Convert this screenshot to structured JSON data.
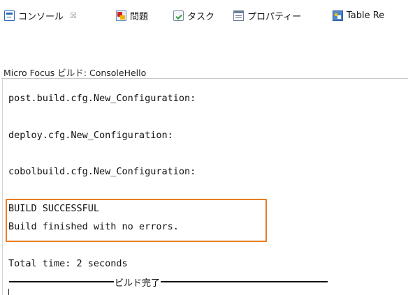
{
  "tabs": [
    {
      "label": "コンソール",
      "icon": "console-icon",
      "closable": true,
      "close_glyph": "☒",
      "active": true
    },
    {
      "label": "問題",
      "icon": "problems-icon"
    },
    {
      "label": "タスク",
      "icon": "tasks-icon"
    },
    {
      "label": "プロパティー",
      "icon": "properties-icon"
    },
    {
      "label": "Table Re",
      "icon": "table-icon"
    }
  ],
  "console": {
    "title": "Micro Focus ビルド: ConsoleHello",
    "lines": [
      "post.build.cfg.New_Configuration:",
      "deploy.cfg.New_Configuration:",
      "cobolbuild.cfg.New_Configuration:",
      "BUILD SUCCESSFUL",
      "Build finished with no errors.",
      "Total time: 2 seconds"
    ],
    "finish_label": "ビルド完了"
  },
  "colors": {
    "highlight_border": "#e67e22",
    "console_icon": "#2a6ab8"
  }
}
